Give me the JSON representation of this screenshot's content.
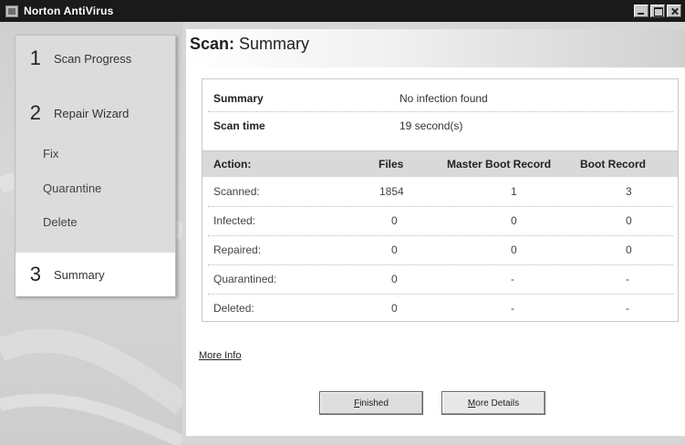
{
  "window": {
    "title": "Norton AntiVirus"
  },
  "nav": {
    "steps": [
      {
        "num": "1",
        "label": "Scan Progress"
      },
      {
        "num": "2",
        "label": "Repair Wizard"
      },
      {
        "num": "3",
        "label": "Summary"
      }
    ],
    "sub_items": [
      "Fix",
      "Quarantine",
      "Delete"
    ],
    "active_step": "Summary"
  },
  "main": {
    "title_bold": "Scan:",
    "title_rest": " Summary",
    "summary": [
      {
        "label": "Summary",
        "value": "No infection found"
      },
      {
        "label": "Scan time",
        "value": "19 second(s)"
      }
    ],
    "results": {
      "columns": [
        "Action:",
        "Files",
        "Master Boot Record",
        "Boot Record"
      ],
      "rows": [
        [
          "Scanned:",
          "1854",
          "1",
          "3"
        ],
        [
          "Infected:",
          "0",
          "0",
          "0"
        ],
        [
          "Repaired:",
          "0",
          "0",
          "0"
        ],
        [
          "Quarantined:",
          "0",
          "-",
          "-"
        ],
        [
          "Deleted:",
          "0",
          "-",
          "-"
        ]
      ]
    },
    "more_info_link": "More Info",
    "buttons": {
      "finished": "Finished",
      "more_details": "More Details"
    }
  },
  "colors": {
    "titlebar": "#1a1a1a",
    "header_band": "#d9d9d9",
    "panel": "#dcdcdc"
  }
}
